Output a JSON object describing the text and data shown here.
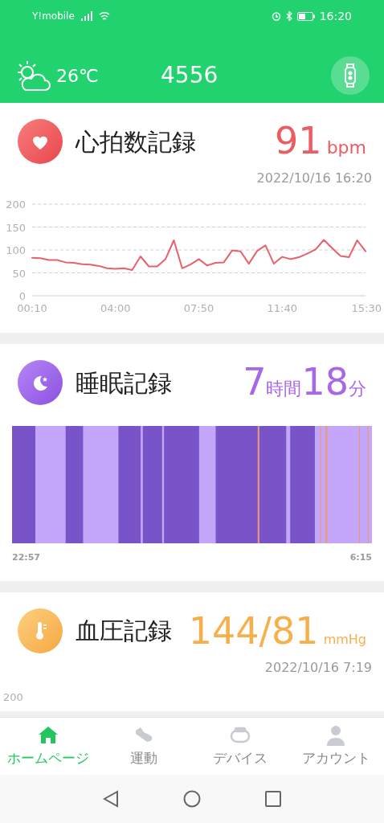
{
  "status_bar": {
    "carrier": "Y!mobile",
    "time": "16:20"
  },
  "header": {
    "temperature": "26℃",
    "steps": "4556"
  },
  "cards": [
    {
      "kind": "heart",
      "title": "心拍数記録",
      "value": "91",
      "unit": "bpm",
      "timestamp": "2022/10/16 16:20",
      "chart_data": {
        "type": "line",
        "categories": [
          "00:10",
          null,
          null,
          null,
          null,
          null,
          null,
          null,
          null,
          null,
          "04:00",
          null,
          null,
          null,
          null,
          null,
          null,
          null,
          null,
          null,
          "07:50",
          null,
          null,
          null,
          null,
          null,
          null,
          null,
          null,
          null,
          "11:40",
          null,
          null,
          null,
          null,
          null,
          null,
          null,
          null,
          null,
          "15:30"
        ],
        "series": [
          {
            "color": "#e8616a",
            "values": [
              83,
              82,
              78,
              78,
              73,
              72,
              69,
              68,
              65,
              60,
              59,
              60,
              56,
              86,
              64,
              64,
              80,
              121,
              60,
              68,
              80,
              66,
              72,
              73,
              99,
              97,
              70,
              98,
              110,
              70,
              85,
              80,
              84,
              92,
              101,
              122,
              104,
              87,
              84,
              121,
              97
            ]
          }
        ],
        "ylim": [
          0,
          200
        ],
        "yticks": [
          0,
          50,
          100,
          150,
          200
        ],
        "grid": true
      }
    },
    {
      "kind": "sleep",
      "title": "睡眠記録",
      "hours": "7",
      "hours_unit": "時間",
      "minutes": "18",
      "minutes_unit": "分",
      "start": "22:57",
      "end": "6:15"
    },
    {
      "kind": "pressure",
      "title": "血圧記録",
      "value": "144/81",
      "unit": "mmHg",
      "timestamp": "2022/10/16 7:19",
      "axis_label": "200"
    }
  ],
  "bottom_nav": [
    {
      "kind": "home",
      "label": "ホームページ",
      "selected": true
    },
    {
      "kind": "shoe",
      "label": "運動",
      "selected": false
    },
    {
      "kind": "band",
      "label": "デバイス",
      "selected": false
    },
    {
      "kind": "person",
      "label": "アカウント",
      "selected": false
    }
  ]
}
